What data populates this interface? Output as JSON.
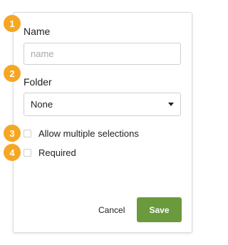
{
  "steps": [
    "1",
    "2",
    "3",
    "4"
  ],
  "form": {
    "name_label": "Name",
    "name_placeholder": "name",
    "name_value": "",
    "folder_label": "Folder",
    "folder_value": "None",
    "allow_multiple_label": "Allow multiple selections",
    "allow_multiple_checked": false,
    "required_label": "Required",
    "required_checked": false
  },
  "actions": {
    "cancel_label": "Cancel",
    "save_label": "Save"
  },
  "colors": {
    "step_badge": "#f5a623",
    "save_button": "#6a9a3c"
  }
}
